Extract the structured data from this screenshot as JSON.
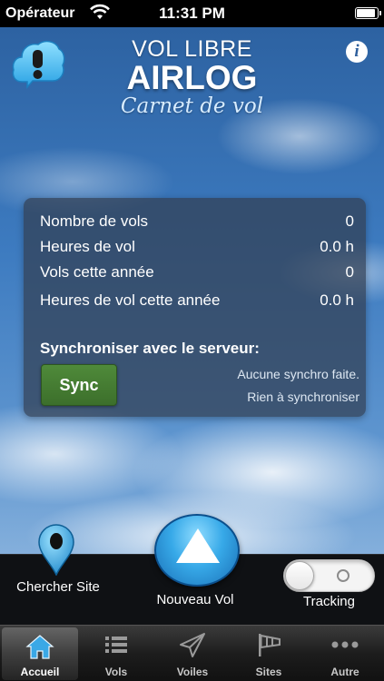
{
  "status_bar": {
    "carrier": "Opérateur",
    "time": "11:31 PM",
    "battery_level": 0.95
  },
  "header": {
    "title_top": "VOL LIBRE",
    "title_main": "AIRLOG",
    "subtitle": "Carnet de vol",
    "alert_icon": "exclamation-speech-bubble-icon",
    "info_icon": "info-icon",
    "info_glyph": "i"
  },
  "stats": {
    "rows": [
      {
        "label": "Nombre de vols",
        "value": "0"
      },
      {
        "label": "Heures de vol",
        "value": "0.0 h"
      },
      {
        "label": "Vols cette année",
        "value": "0"
      },
      {
        "label": "Heures de vol cette année",
        "value": "0.0 h"
      }
    ],
    "sync_title": "Synchroniser avec le serveur:",
    "sync_button": "Sync",
    "sync_status_1": "Aucune synchro faite.",
    "sync_status_2": "Rien à synchroniser"
  },
  "actions": {
    "chercher_site": "Chercher Site",
    "nouveau_vol": "Nouveau Vol",
    "tracking": "Tracking",
    "tracking_on": false
  },
  "tabs": [
    {
      "label": "Accueil",
      "icon": "home-icon",
      "active": true
    },
    {
      "label": "Vols",
      "icon": "list-icon",
      "active": false
    },
    {
      "label": "Voiles",
      "icon": "paper-plane-icon",
      "active": false
    },
    {
      "label": "Sites",
      "icon": "windsock-icon",
      "active": false
    },
    {
      "label": "Autre",
      "icon": "more-icon",
      "active": false
    }
  ],
  "colors": {
    "sync_button": "#3c6f2b",
    "nouveau_button": "#37a9e8",
    "pin": "#3aa8e6"
  }
}
